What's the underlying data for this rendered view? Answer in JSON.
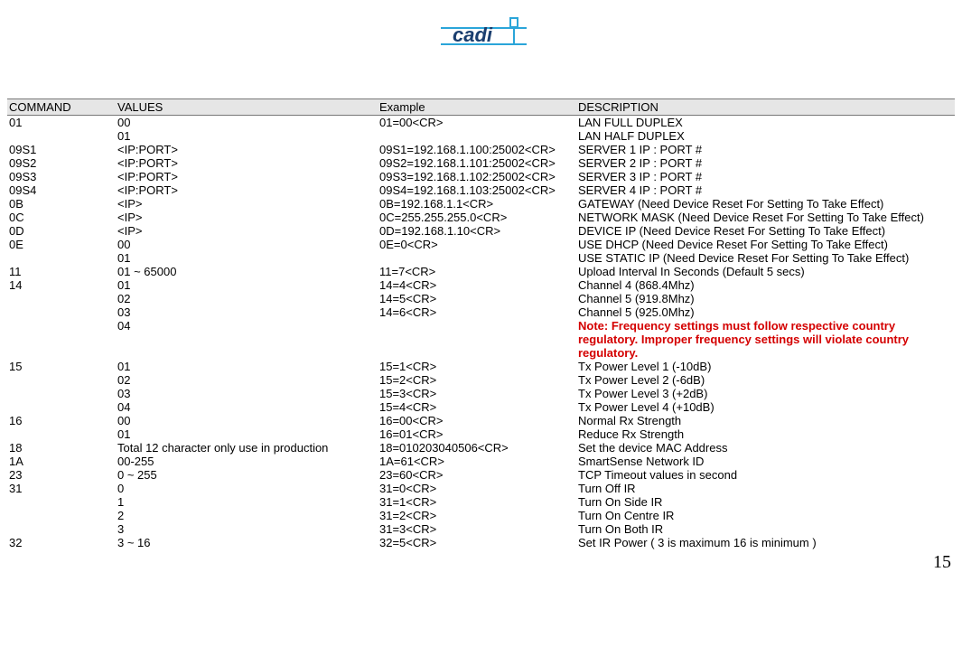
{
  "page_number": "15",
  "headers": {
    "col1": "COMMAND",
    "col2": "VALUES",
    "col3": "Example",
    "col4": "DESCRIPTION"
  },
  "rows": [
    {
      "c1": "01",
      "c2": "00",
      "c3": "01=00<CR>",
      "c4": "LAN FULL DUPLEX",
      "note": false
    },
    {
      "c1": "",
      "c2": "01",
      "c3": "",
      "c4": "LAN HALF DUPLEX",
      "note": false
    },
    {
      "c1": "09S1",
      "c2": "<IP:PORT>",
      "c3": "09S1=192.168.1.100:25002<CR>",
      "c4": "SERVER 1 IP : PORT #",
      "note": false
    },
    {
      "c1": "09S2",
      "c2": "<IP:PORT>",
      "c3": "09S2=192.168.1.101:25002<CR>",
      "c4": "SERVER 2 IP : PORT #",
      "note": false
    },
    {
      "c1": "09S3",
      "c2": "<IP:PORT>",
      "c3": "09S3=192.168.1.102:25002<CR>",
      "c4": "SERVER 3 IP : PORT #",
      "note": false
    },
    {
      "c1": "09S4",
      "c2": "<IP:PORT>",
      "c3": "09S4=192.168.1.103:25002<CR>",
      "c4": "SERVER 4 IP : PORT #",
      "note": false
    },
    {
      "c1": "0B",
      "c2": "<IP>",
      "c3": "0B=192.168.1.1<CR>",
      "c4": "GATEWAY (Need Device Reset For Setting To Take Effect)",
      "note": false
    },
    {
      "c1": "0C",
      "c2": "<IP>",
      "c3": "0C=255.255.255.0<CR>",
      "c4": "NETWORK MASK (Need Device Reset For Setting To Take Effect)",
      "note": false
    },
    {
      "c1": "0D",
      "c2": "<IP>",
      "c3": "0D=192.168.1.10<CR>",
      "c4": "DEVICE IP (Need Device Reset For Setting To Take Effect)",
      "note": false
    },
    {
      "c1": "0E",
      "c2": "00",
      "c3": "0E=0<CR>",
      "c4": "USE DHCP (Need Device Reset For Setting To Take Effect)",
      "note": false
    },
    {
      "c1": "",
      "c2": "01",
      "c3": "",
      "c4": "USE STATIC IP (Need Device Reset For Setting To Take Effect)",
      "note": false
    },
    {
      "c1": "11",
      "c2": "01 ~ 65000",
      "c3": "11=7<CR>",
      "c4": "Upload Interval In Seconds (Default 5 secs)",
      "note": false
    },
    {
      "c1": "14",
      "c2": "01",
      "c3": "14=4<CR>",
      "c4": "Channel 4 (868.4Mhz)",
      "note": false
    },
    {
      "c1": "",
      "c2": "02",
      "c3": "14=5<CR>",
      "c4": "Channel 5 (919.8Mhz)",
      "note": false
    },
    {
      "c1": "",
      "c2": "03",
      "c3": "14=6<CR>",
      "c4": "Channel 5 (925.0Mhz)",
      "note": false
    },
    {
      "c1": "",
      "c2": "04",
      "c3": "",
      "c4": "Note: Frequency settings must follow respective country regulatory. Improper frequency settings will violate country regulatory.",
      "note": true
    },
    {
      "c1": "15",
      "c2": "01",
      "c3": "15=1<CR>",
      "c4": "Tx Power Level 1 (-10dB)",
      "note": false
    },
    {
      "c1": "",
      "c2": "02",
      "c3": "15=2<CR>",
      "c4": "Tx Power Level 2 (-6dB)",
      "note": false
    },
    {
      "c1": "",
      "c2": "03",
      "c3": "15=3<CR>",
      "c4": "Tx Power Level 3 (+2dB)",
      "note": false
    },
    {
      "c1": "",
      "c2": "04",
      "c3": "15=4<CR>",
      "c4": "Tx Power Level 4 (+10dB)",
      "note": false
    },
    {
      "c1": "16",
      "c2": "00",
      "c3": "16=00<CR>",
      "c4": "Normal Rx Strength",
      "note": false
    },
    {
      "c1": "",
      "c2": "01",
      "c3": "16=01<CR>",
      "c4": "Reduce Rx Strength",
      "note": false
    },
    {
      "c1": "18",
      "c2": "Total 12 character only use in production",
      "c3": "18=010203040506<CR>",
      "c4": "Set the device MAC Address",
      "note": false
    },
    {
      "c1": "1A",
      "c2": "00-255",
      "c3": "1A=61<CR>",
      "c4": "SmartSense Network ID",
      "note": false
    },
    {
      "c1": "23",
      "c2": "0 ~ 255",
      "c3": "23=60<CR>",
      "c4": "TCP Timeout values in second",
      "note": false
    },
    {
      "c1": "31",
      "c2": "0",
      "c3": "31=0<CR>",
      "c4": "Turn Off IR",
      "note": false
    },
    {
      "c1": "",
      "c2": "1",
      "c3": "31=1<CR>",
      "c4": "Turn On Side IR",
      "note": false
    },
    {
      "c1": "",
      "c2": "2",
      "c3": "31=2<CR>",
      "c4": "Turn On Centre IR",
      "note": false
    },
    {
      "c1": "",
      "c2": "3",
      "c3": "31=3<CR>",
      "c4": "Turn On Both IR",
      "note": false
    },
    {
      "c1": "32",
      "c2": "3 ~ 16",
      "c3": "32=5<CR>",
      "c4": "Set IR Power ( 3 is maximum 16 is minimum )",
      "note": false
    }
  ]
}
